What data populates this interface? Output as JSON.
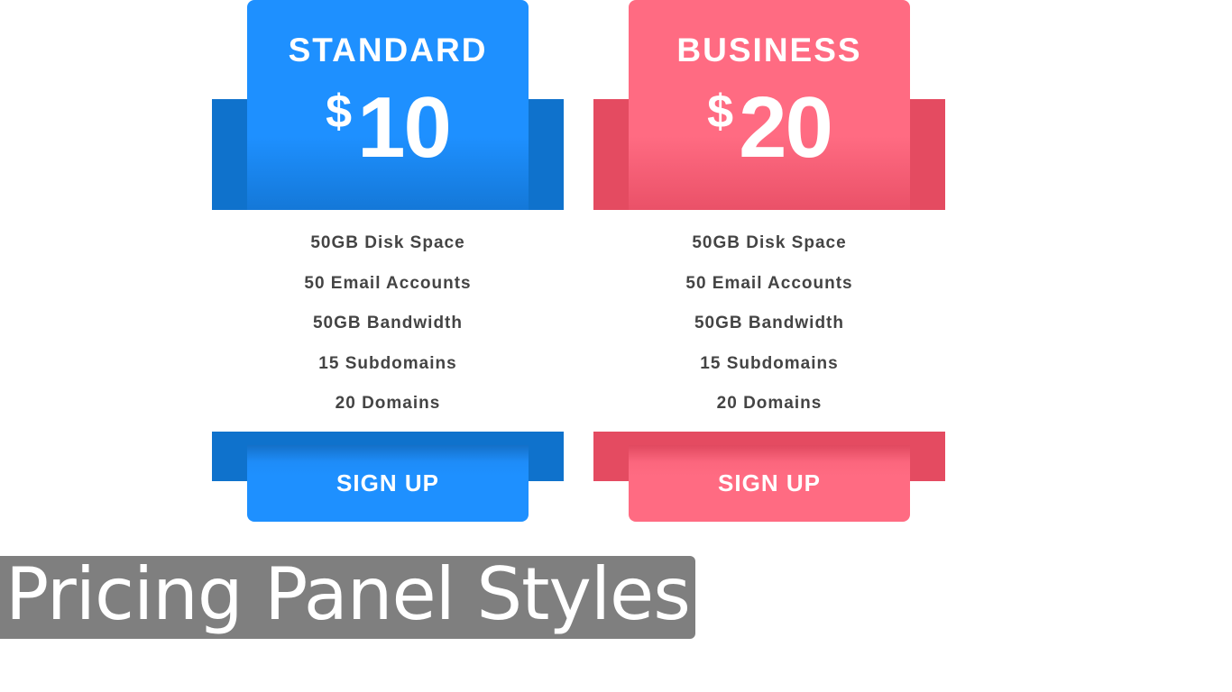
{
  "plans": [
    {
      "name": "STANDARD",
      "currency": "$",
      "price": "10",
      "features": [
        "50GB Disk Space",
        "50 Email Accounts",
        "50GB Bandwidth",
        "15 Subdomains",
        "20 Domains"
      ],
      "button_label": "SIGN UP",
      "accent_color": "#1e90ff",
      "band_color": "#0f72cc"
    },
    {
      "name": "BUSINESS",
      "currency": "$",
      "price": "20",
      "features": [
        "50GB Disk Space",
        "50 Email Accounts",
        "50GB Bandwidth",
        "15 Subdomains",
        "20 Domains"
      ],
      "button_label": "SIGN UP",
      "accent_color": "#ff6b82",
      "band_color": "#e44b61"
    }
  ],
  "caption": {
    "title": "Pricing Panel Styles"
  }
}
